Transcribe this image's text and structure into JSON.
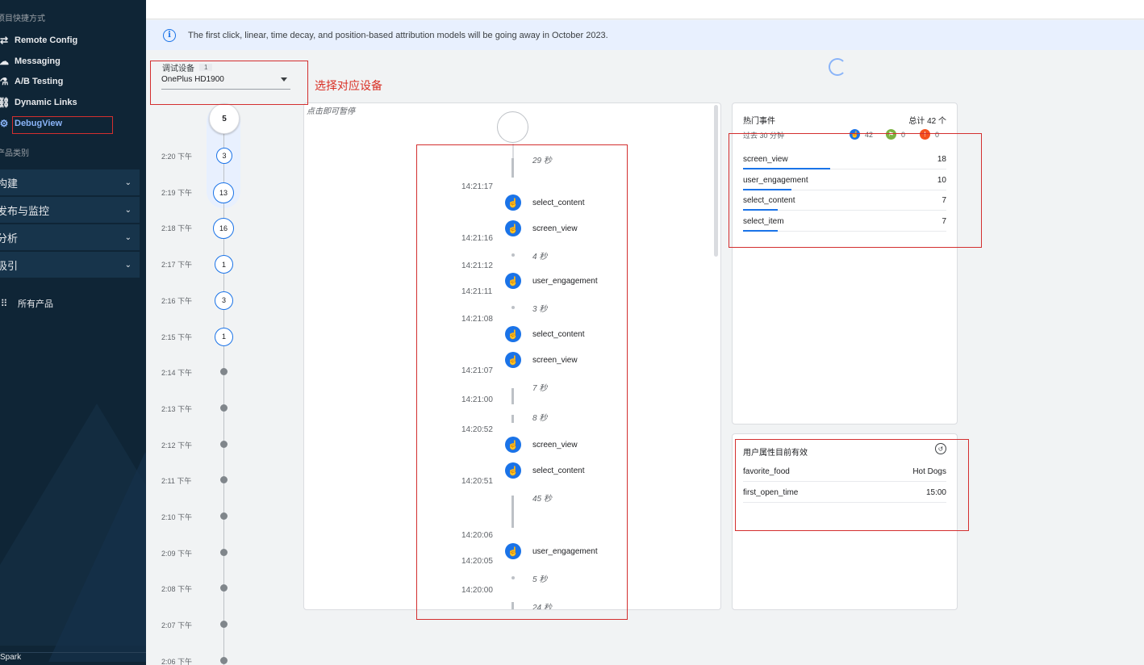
{
  "sidebar": {
    "shortcuts_heading": "项目快捷方式",
    "shortcuts": [
      {
        "label": "Remote Config",
        "icon": "remote-config-icon"
      },
      {
        "label": "Messaging",
        "icon": "messaging-icon"
      },
      {
        "label": "A/B Testing",
        "icon": "ab-testing-icon"
      },
      {
        "label": "Dynamic Links",
        "icon": "dynamic-links-icon"
      },
      {
        "label": "DebugView",
        "icon": "debugview-icon",
        "active": true
      }
    ],
    "categories_heading": "产品类别",
    "groups": [
      {
        "label": "构建"
      },
      {
        "label": "发布与监控"
      },
      {
        "label": "分析"
      },
      {
        "label": "吸引"
      }
    ],
    "all_products": "所有产品",
    "bottom_label": "Spark"
  },
  "banner": {
    "text": "The first click, linear, time decay, and position-based attribution models will be going away in October 2023."
  },
  "device": {
    "label": "调试设备",
    "count": "1",
    "selected": "OnePlus HD1900"
  },
  "annotation": {
    "text": "选择对应设备"
  },
  "minutes": {
    "current_count": "5",
    "rows": [
      {
        "time": "2:20 下午",
        "count": "3"
      },
      {
        "time": "2:19 下午",
        "count": "13"
      },
      {
        "time": "2:18 下午",
        "count": "16"
      },
      {
        "time": "2:17 下午",
        "count": "1"
      },
      {
        "time": "2:16 下午",
        "count": "3"
      },
      {
        "time": "2:15 下午",
        "count": "1"
      },
      {
        "time": "2:14 下午",
        "count": null
      },
      {
        "time": "2:13 下午",
        "count": null
      },
      {
        "time": "2:12 下午",
        "count": null
      },
      {
        "time": "2:11 下午",
        "count": null
      },
      {
        "time": "2:10 下午",
        "count": null
      },
      {
        "time": "2:09 下午",
        "count": null
      },
      {
        "time": "2:08 下午",
        "count": null
      },
      {
        "time": "2:07 下午",
        "count": null
      },
      {
        "time": "2:06 下午",
        "count": null
      }
    ]
  },
  "stream": {
    "pause_hint": "点击即可暂停",
    "gaps": [
      "29 秒",
      "4 秒",
      "3 秒",
      "7 秒",
      "8 秒",
      "45 秒",
      "5 秒",
      "24 秒"
    ],
    "times": [
      "14:21:17",
      "14:21:16",
      "14:21:12",
      "14:21:11",
      "14:21:08",
      "14:21:07",
      "14:21:00",
      "14:20:52",
      "14:20:51",
      "14:20:06",
      "14:20:05",
      "14:20:00"
    ],
    "events": [
      "select_content",
      "screen_view",
      "user_engagement",
      "select_content",
      "screen_view",
      "screen_view",
      "select_content",
      "user_engagement"
    ]
  },
  "top_events": {
    "title": "热门事件",
    "total": "总计 42 个",
    "period": "过去 30 分钟",
    "stats": [
      {
        "icon": "hand-icon",
        "value": "42",
        "color": "#1a73e8"
      },
      {
        "icon": "flag-icon",
        "value": "0",
        "color": "#7cb342"
      },
      {
        "icon": "warning-icon",
        "value": "0",
        "color": "#f4511e"
      }
    ],
    "rows": [
      {
        "name": "screen_view",
        "count": "18",
        "share": 0.43
      },
      {
        "name": "user_engagement",
        "count": "10",
        "share": 0.24
      },
      {
        "name": "select_content",
        "count": "7",
        "share": 0.17
      },
      {
        "name": "select_item",
        "count": "7",
        "share": 0.17
      }
    ]
  },
  "user_props": {
    "title": "用户属性目前有效",
    "rows": [
      {
        "name": "favorite_food",
        "value": "Hot Dogs"
      },
      {
        "name": "first_open_time",
        "value": "15:00"
      }
    ]
  }
}
